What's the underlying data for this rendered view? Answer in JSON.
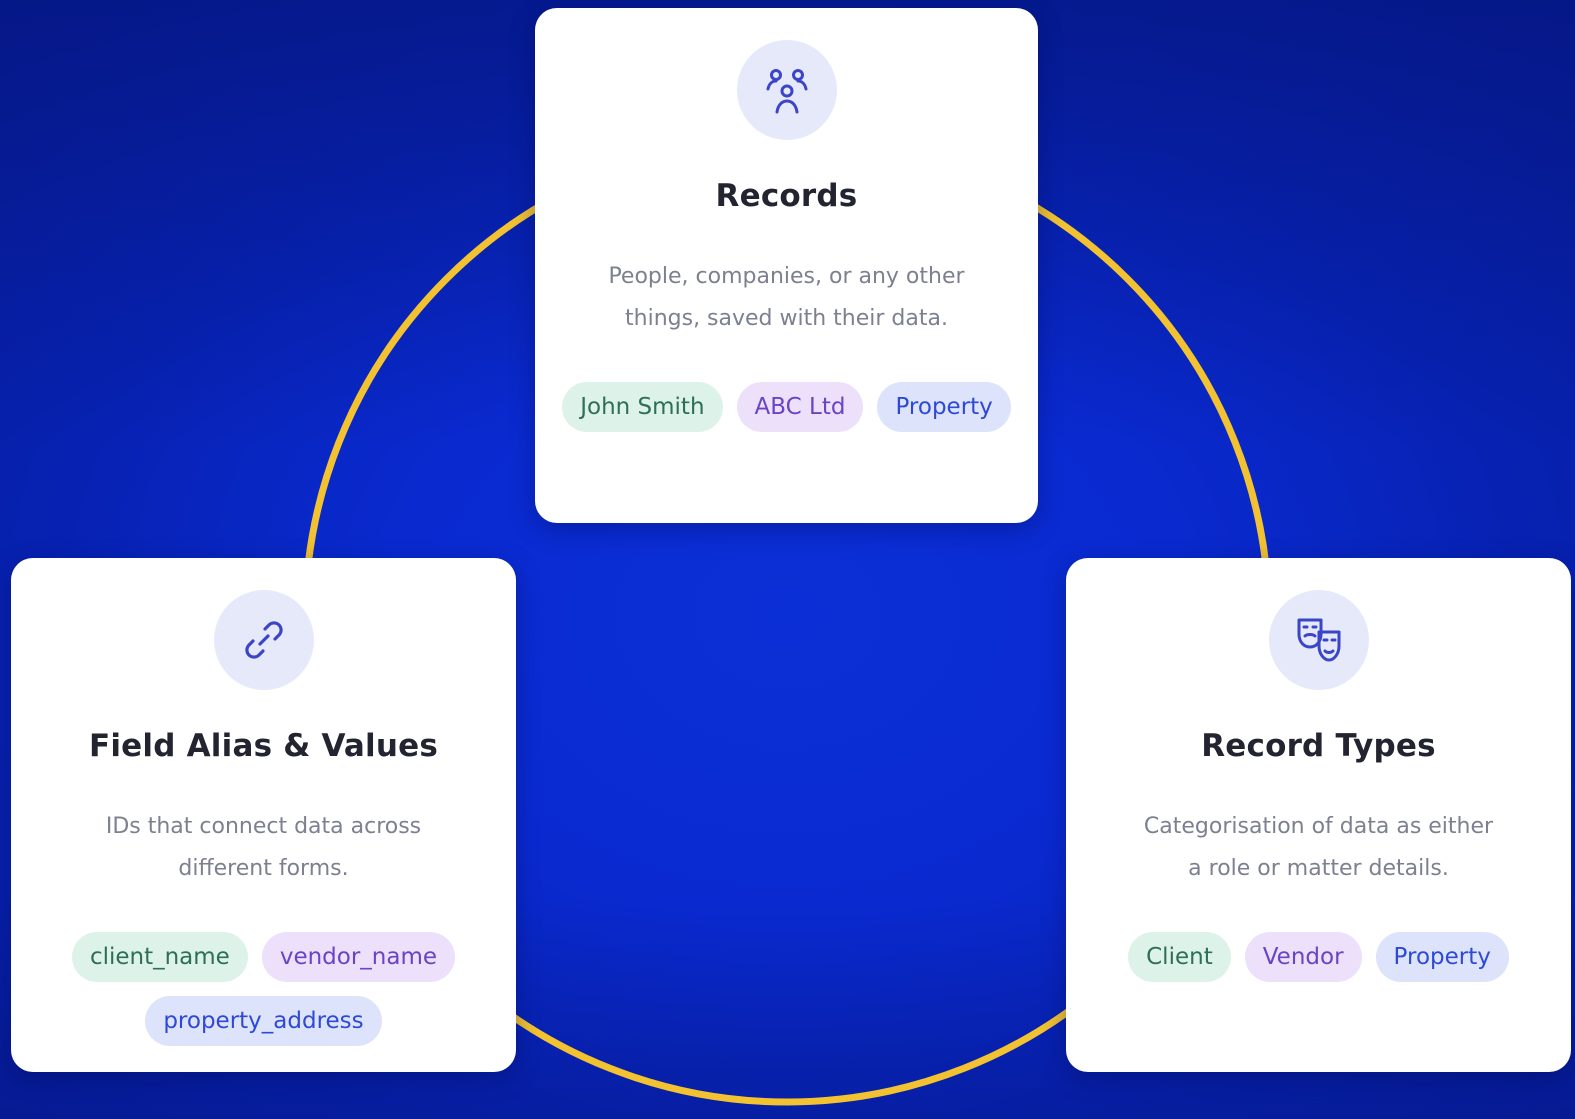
{
  "colors": {
    "background": "#0a2ad0",
    "ring": "#f2c230",
    "card": "#ffffff",
    "icon_bg": "#e6e9fa",
    "icon_stroke": "#3b45c8",
    "tag_green_bg": "#ddf3ea",
    "tag_purple_bg": "#ece0fb",
    "tag_blue_bg": "#dde3fb"
  },
  "cards": {
    "records": {
      "icon": "people-group-icon",
      "title": "Records",
      "description_lines": [
        "People, companies, or any other",
        "things, saved with their data."
      ],
      "tags": [
        "John Smith",
        "ABC Ltd",
        "Property"
      ]
    },
    "alias": {
      "icon": "link-icon",
      "title": "Field Alias & Values",
      "description_lines": [
        "IDs that connect data across",
        "different forms."
      ],
      "tags": [
        "client_name",
        "vendor_name",
        "property_address"
      ]
    },
    "types": {
      "icon": "theater-masks-icon",
      "title": "Record Types",
      "description_lines": [
        "Categorisation of data as either",
        "a role or matter details."
      ],
      "tags": [
        "Client",
        "Vendor",
        "Property"
      ]
    }
  }
}
